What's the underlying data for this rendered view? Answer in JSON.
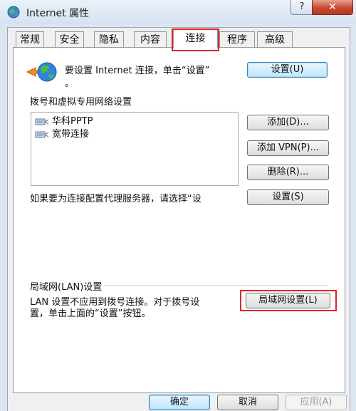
{
  "window": {
    "title": "Internet 属性",
    "help_label": "?",
    "close_label": "✕"
  },
  "tabs": [
    {
      "label": "常规",
      "active": false
    },
    {
      "label": "安全",
      "active": false
    },
    {
      "label": "隐私",
      "active": false
    },
    {
      "label": "内容",
      "active": false
    },
    {
      "label": "连接",
      "active": true
    },
    {
      "label": "程序",
      "active": false
    },
    {
      "label": "高级",
      "active": false
    }
  ],
  "setup": {
    "text_line1": "要设置 Internet 连接，单击“设置”",
    "text_line2": "。",
    "button": "设置(U)"
  },
  "dialup": {
    "heading": "拨号和虚拟专用网络设置",
    "connections": [
      "华科PPTP",
      "宽带连接"
    ],
    "add_button": "添加(D)...",
    "add_vpn_button": "添加 VPN(P)...",
    "remove_button": "删除(R)...",
    "proxy_text": "如果要为连接配置代理服务器，请选择“设",
    "settings_button": "设置(S)"
  },
  "lan": {
    "heading": "局域网(LAN)设置",
    "text_line1": "LAN 设置不应用到拨号连接。对于拨号设",
    "text_line2": "置，单击上面的“设置”按钮。",
    "button": "局域网设置(L)"
  },
  "footer": {
    "ok": "确定",
    "cancel": "取消",
    "apply": "应用(A)"
  },
  "colors": {
    "highlight": "#e02525",
    "titlebar": "#dbe6f2"
  }
}
